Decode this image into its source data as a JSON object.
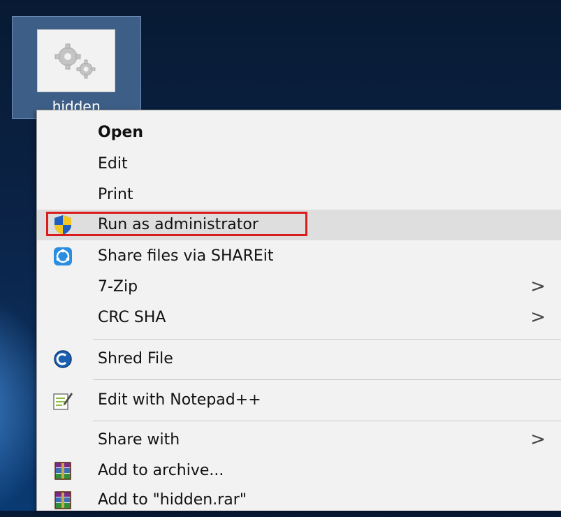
{
  "desktop": {
    "icon_label": "hidden",
    "icon_name": "gears-file-icon"
  },
  "context_menu": {
    "items": [
      {
        "label": "Open",
        "bold": true,
        "icon": null,
        "submenu": false
      },
      {
        "label": "Edit",
        "bold": false,
        "icon": null,
        "submenu": false
      },
      {
        "label": "Print",
        "bold": false,
        "icon": null,
        "submenu": false
      },
      {
        "label": "Run as administrator",
        "bold": false,
        "icon": "uac-shield-icon",
        "submenu": false,
        "highlighted": true,
        "outlined": true
      },
      {
        "label": "Share files via SHAREit",
        "bold": false,
        "icon": "shareit-icon",
        "submenu": false
      },
      {
        "label": "7-Zip",
        "bold": false,
        "icon": null,
        "submenu": true
      },
      {
        "label": "CRC SHA",
        "bold": false,
        "icon": null,
        "submenu": true
      },
      {
        "label": "Shred File",
        "bold": false,
        "icon": "shred-file-icon",
        "submenu": false
      },
      {
        "label": "Edit with Notepad++",
        "bold": false,
        "icon": "notepad-plus-plus-icon",
        "submenu": false
      },
      {
        "label": "Share with",
        "bold": false,
        "icon": null,
        "submenu": true
      },
      {
        "label": "Add to archive...",
        "bold": false,
        "icon": "winrar-icon",
        "submenu": false
      },
      {
        "label": "Add to \"hidden.rar\"",
        "bold": false,
        "icon": "winrar-icon",
        "submenu": false
      }
    ],
    "submenu_arrow": ">"
  },
  "colors": {
    "highlight": "#dedede",
    "outline": "#d91d1d",
    "menu_bg": "#f2f2f2"
  }
}
